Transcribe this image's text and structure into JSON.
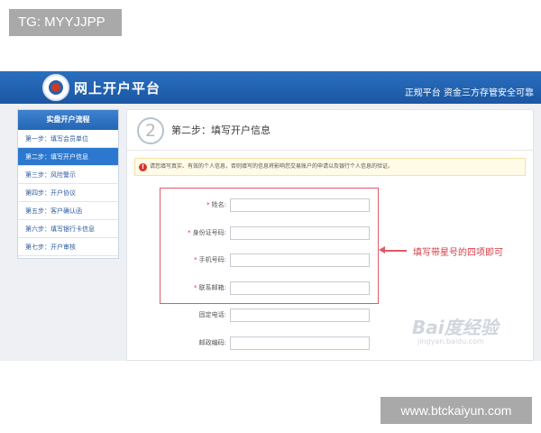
{
  "overlay": {
    "top_tag": "TG: MYYJJPP",
    "bottom_tag": "www.btckaiyun.com"
  },
  "header": {
    "site_title": "网上开户平台",
    "slogan": "正规平台 资金三方存管安全可靠"
  },
  "sidebar": {
    "heading": "实盘开户流程",
    "items": [
      {
        "label": "第一步：填写会员单位"
      },
      {
        "label": "第二步：填写开户信息",
        "active": true
      },
      {
        "label": "第三步：风险警示"
      },
      {
        "label": "第四步：开户协议"
      },
      {
        "label": "第五步：客户确认函"
      },
      {
        "label": "第六步：填写银行卡信息"
      },
      {
        "label": "第七步：开户审核"
      }
    ]
  },
  "main": {
    "step_number": "2",
    "step_title": "第二步：填写开户信息",
    "notice": "请您填写真实、有效的个人信息，否则填写的信息将影响您交易账户的申请以及银行个人信息的验证。",
    "fields": [
      {
        "label": "姓名:",
        "required": "*",
        "value": ""
      },
      {
        "label": "身份证号码:",
        "required": "*",
        "value": ""
      },
      {
        "label": "手机号码:",
        "required": "*",
        "value": ""
      },
      {
        "label": "联系邮箱:",
        "required": "*",
        "value": ""
      },
      {
        "label": "固定电话:",
        "required": "",
        "value": ""
      },
      {
        "label": "邮政编码:",
        "required": "",
        "value": ""
      }
    ],
    "callout": "填写带星号的四项即可"
  },
  "watermark": {
    "text": "Bai度经验",
    "sub": "jingyan.baidu.com"
  },
  "colors": {
    "header_blue": "#1b57a3",
    "active_item": "#2c78cf",
    "annotation_red": "#e05a66",
    "tag_gray": "#a9a9a9"
  },
  "icons": {
    "logo": "logo-emblem-icon",
    "notice": "warning-icon",
    "arrow": "arrow-left-icon"
  }
}
